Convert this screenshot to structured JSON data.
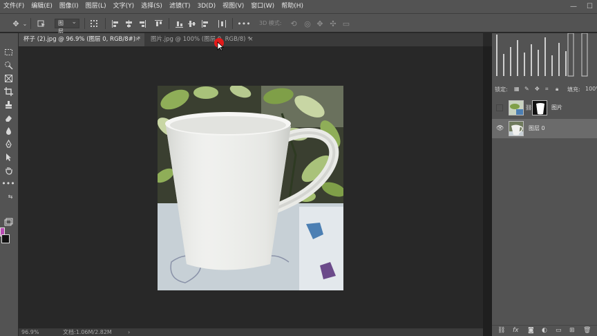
{
  "menu": {
    "items": [
      "文件(F)",
      "编辑(E)",
      "图像(I)",
      "图层(L)",
      "文字(Y)",
      "选择(S)",
      "滤镜(T)",
      "3D(D)",
      "视图(V)",
      "窗口(W)",
      "帮助(H)"
    ]
  },
  "window_controls": {
    "minimize": "—",
    "maximize": "☐"
  },
  "options_bar": {
    "auto_select_target": "图层",
    "mode_3d_label": "3D 模式:",
    "more_label": "•••"
  },
  "tabs": [
    {
      "label": "杯子 (2).jpg @ 96.9% (图层 0, RGB/8#) *",
      "active": true
    },
    {
      "label": "图片.jpg @ 100% (图层 0, RGB/8) *",
      "active": false
    }
  ],
  "tab_close_glyph": "×",
  "status": {
    "zoom": "96.9%",
    "doc_info": "文档:1.06M/2.82M",
    "arrow": "›"
  },
  "layers_panel": {
    "lock_label": "锁定:",
    "fill_label": "填充:",
    "fill_value": "100%",
    "layers": [
      {
        "name": "图片",
        "visible": false,
        "selected": false,
        "has_mask": true
      },
      {
        "name": "图层 0",
        "visible": true,
        "selected": true,
        "has_mask": false
      }
    ],
    "footer_icons": [
      "link-icon",
      "fx-icon",
      "mask-icon",
      "adjustment-icon",
      "group-icon",
      "new-layer-icon",
      "trash-icon"
    ],
    "footer_fx": "fx"
  },
  "colors": {
    "foreground": "#b84ab2",
    "background": "#111111",
    "ui_panel": "#535353",
    "canvas_bg": "#282828"
  }
}
